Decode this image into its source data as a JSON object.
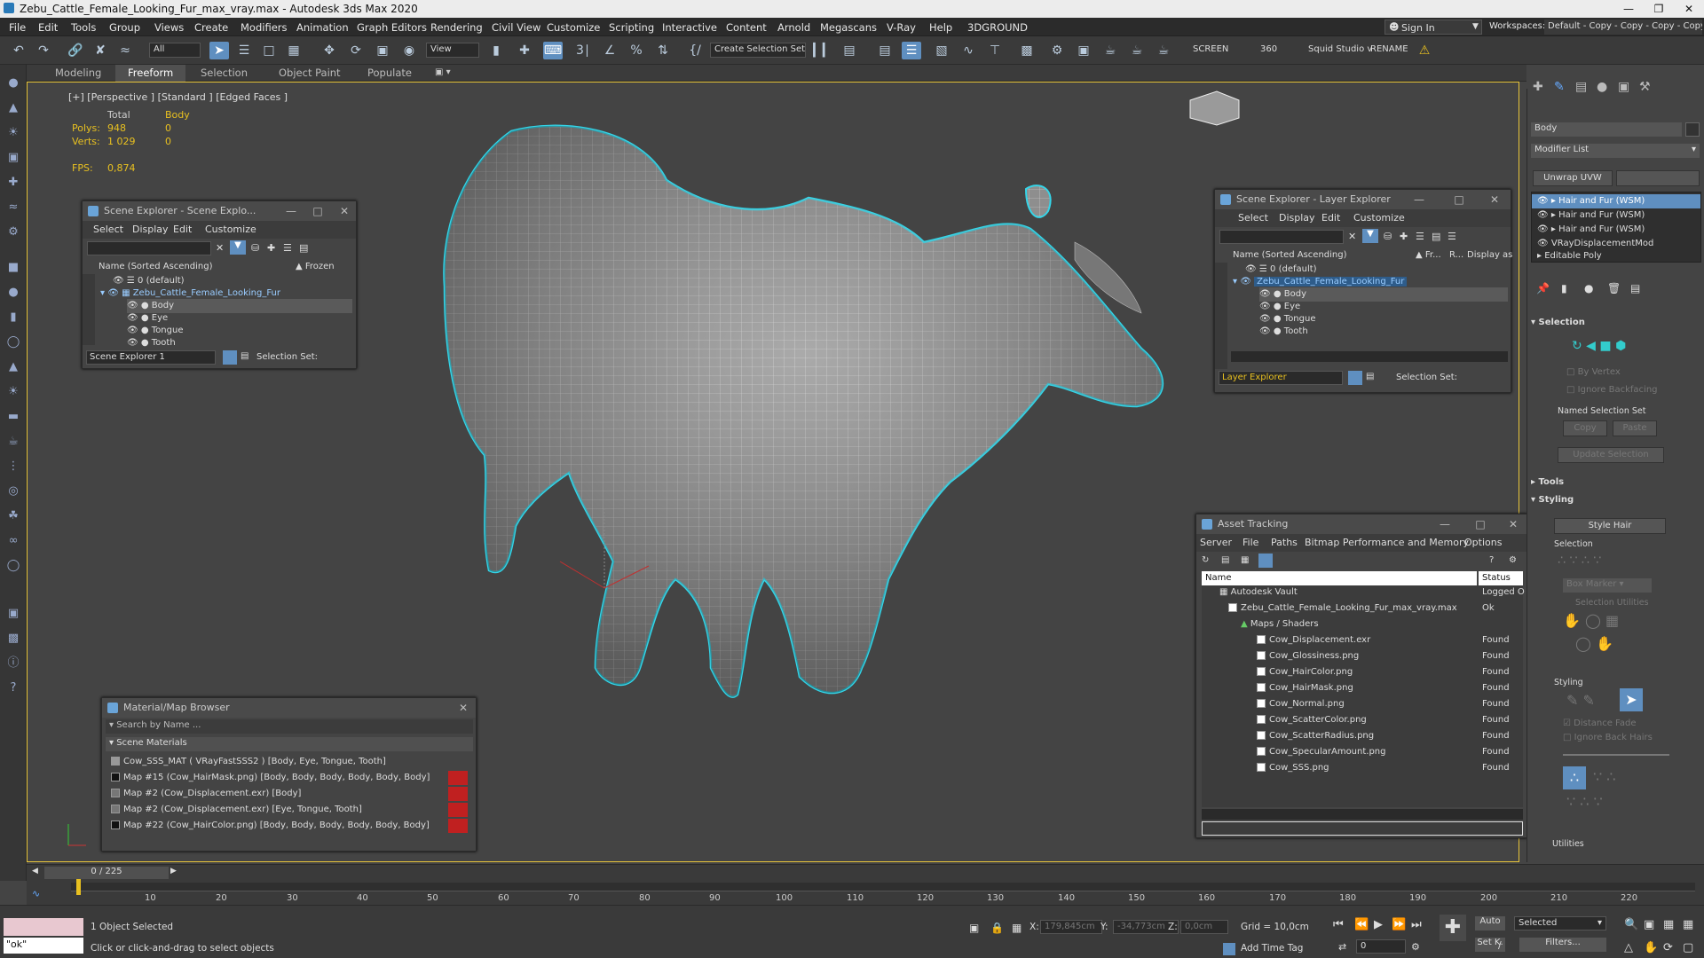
{
  "window": {
    "title": "Zebu_Cattle_Female_Looking_Fur_max_vray.max - Autodesk 3ds Max 2020"
  },
  "menu": [
    "File",
    "Edit",
    "Tools",
    "Group",
    "Views",
    "Create",
    "Modifiers",
    "Animation",
    "Graph Editors",
    "Rendering",
    "Civil View",
    "Customize",
    "Scripting",
    "Interactive",
    "Content",
    "Arnold",
    "Megascans",
    "V-Ray",
    "Help",
    "3DGROUND"
  ],
  "account": {
    "sign_in": "Sign In",
    "workspaces_label": "Workspaces:",
    "workspace": "Default - Copy - Copy - Copy - Copy"
  },
  "toolbar": {
    "filter": "All",
    "view": "View",
    "selection_set": "Create Selection Set",
    "screen": "SCREEN",
    "deg": "360",
    "squid": "Squid Studio v",
    "rename": "RENAME"
  },
  "ribbon": {
    "tabs": [
      "Modeling",
      "Freeform",
      "Selection",
      "Object Paint",
      "Populate"
    ],
    "active": "Freeform"
  },
  "viewport": {
    "label": "[+] [Perspective ] [Standard ] [Edged Faces ]",
    "stats": {
      "col_total": "Total",
      "col_body": "Body",
      "polys_label": "Polys:",
      "polys_total": "948",
      "polys_body": "0",
      "verts_label": "Verts:",
      "verts_total": "1 029",
      "verts_body": "0",
      "fps_label": "FPS:",
      "fps": "0,874"
    }
  },
  "scene_explorer": {
    "title": "Scene Explorer - Scene Explo...",
    "menu": [
      "Select",
      "Display",
      "Edit",
      "Customize"
    ],
    "col_name": "Name (Sorted Ascending)",
    "col_frozen": "▲ Frozen",
    "rows": [
      "0 (default)",
      "Zebu_Cattle_Female_Looking_Fur",
      "Body",
      "Eye",
      "Tongue",
      "Tooth"
    ],
    "footer": "Scene Explorer 1",
    "selection_set": "Selection Set:"
  },
  "layer_explorer": {
    "title": "Scene Explorer - Layer Explorer",
    "menu": [
      "Select",
      "Display",
      "Edit",
      "Customize"
    ],
    "col_name": "Name (Sorted Ascending)",
    "col_fr": "▲ Fr...",
    "col_r": "R...",
    "col_display": "Display as",
    "rows": [
      "0 (default)",
      "Zebu_Cattle_Female_Looking_Fur",
      "Body",
      "Eye",
      "Tongue",
      "Tooth"
    ],
    "footer": "Layer Explorer",
    "selection_set": "Selection Set:"
  },
  "asset_tracking": {
    "title": "Asset Tracking",
    "menu": [
      "Server",
      "File",
      "Paths",
      "Bitmap Performance and Memory",
      "Options"
    ],
    "col_name": "Name",
    "col_status": "Status",
    "rows": [
      {
        "name": "Autodesk Vault",
        "status": "Logged O"
      },
      {
        "name": "Zebu_Cattle_Female_Looking_Fur_max_vray.max",
        "status": "Ok"
      },
      {
        "name": "Maps / Shaders",
        "status": ""
      },
      {
        "name": "Cow_Displacement.exr",
        "status": "Found"
      },
      {
        "name": "Cow_Glossiness.png",
        "status": "Found"
      },
      {
        "name": "Cow_HairColor.png",
        "status": "Found"
      },
      {
        "name": "Cow_HairMask.png",
        "status": "Found"
      },
      {
        "name": "Cow_Normal.png",
        "status": "Found"
      },
      {
        "name": "Cow_ScatterColor.png",
        "status": "Found"
      },
      {
        "name": "Cow_ScatterRadius.png",
        "status": "Found"
      },
      {
        "name": "Cow_SpecularAmount.png",
        "status": "Found"
      },
      {
        "name": "Cow_SSS.png",
        "status": "Found"
      }
    ]
  },
  "material_browser": {
    "title": "Material/Map Browser",
    "search_placeholder": "Search by Name ...",
    "group": "Scene Materials",
    "items": [
      "Cow_SSS_MAT  ( VRayFastSSS2 )  [Body, Eye, Tongue, Tooth]",
      "Map #15 (Cow_HairMask.png)  [Body, Body, Body, Body, Body, Body]",
      "Map #2 (Cow_Displacement.exr)  [Body]",
      "Map #2 (Cow_Displacement.exr)  [Eye, Tongue, Tooth]",
      "Map #22 (Cow_HairColor.png)  [Body, Body, Body, Body, Body, Body]"
    ]
  },
  "command_panel": {
    "object_name": "Body",
    "modifier_list": "Modifier List",
    "unwrap": "Unwrap UVW",
    "stack": [
      "Hair and Fur (WSM)",
      "Hair and Fur (WSM)",
      "Hair and Fur (WSM)",
      "VRayDisplacementMod",
      "Editable Poly"
    ],
    "selection_title": "Selection",
    "by_vertex": "By Vertex",
    "ignore_backfacing": "Ignore Backfacing",
    "named_sel": "Named Selection Set",
    "copy": "Copy",
    "paste": "Paste",
    "update_sel": "Update Selection",
    "tools": "Tools",
    "styling": "Styling",
    "style_hair": "Style Hair",
    "sub_selection": "Selection",
    "box_marker": "Box Marker",
    "sel_utils": "Selection Utilities",
    "sub_styling": "Styling",
    "distance_fade": "Distance Fade",
    "ignore_back_hairs": "Ignore Back Hairs",
    "utilities": "Utilities"
  },
  "timeline": {
    "frame": "0 / 225",
    "ticks": [
      "10",
      "20",
      "30",
      "40",
      "50",
      "60",
      "70",
      "80",
      "90",
      "100",
      "110",
      "120",
      "130",
      "140",
      "150",
      "160",
      "170",
      "180",
      "190",
      "200",
      "210",
      "220"
    ]
  },
  "status": {
    "script": "\"ok\"",
    "selected": "1 Object Selected",
    "hint": "Click or click-and-drag to select objects",
    "x_label": "X:",
    "x": "179,845cm",
    "y_label": "Y:",
    "y": "-34,773cm",
    "z_label": "Z:",
    "z": "0,0cm",
    "grid": "Grid = 10,0cm",
    "add_time_tag": "Add Time Tag",
    "auto": "Auto",
    "set_k": "Set K.",
    "sel_mode": "Selected",
    "filters": "Filters...",
    "frame_field": "0"
  },
  "colors": {
    "accent": "#5f8fc0",
    "viewport_border": "#e8c53a",
    "selection_outline": "#35d5e8",
    "stat_yellow": "#e8c020"
  }
}
